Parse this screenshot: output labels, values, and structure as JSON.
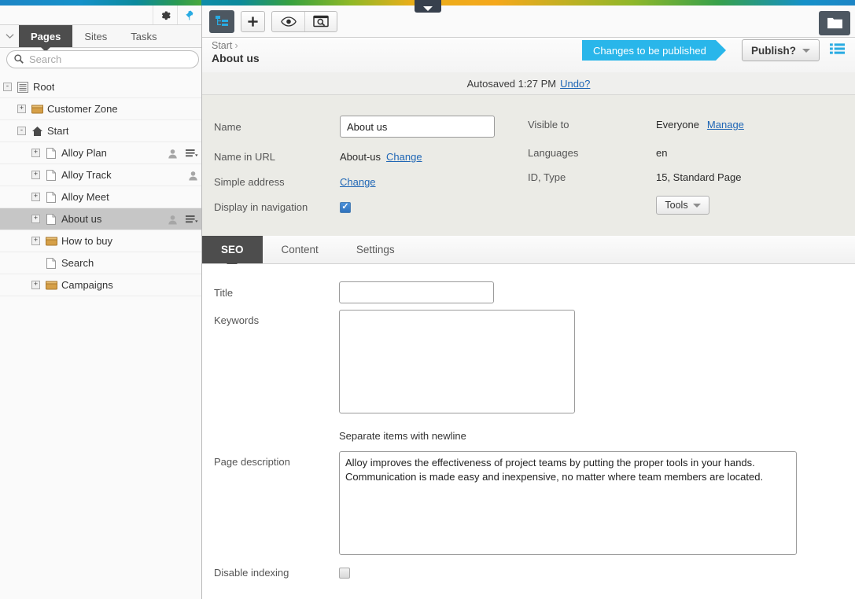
{
  "app": {
    "accent_blue": "#29b6ea",
    "dark_panel": "#4d4d4d"
  },
  "left_panel": {
    "toolbar": {
      "settings_icon": "gear-icon",
      "pin_icon": "pin-icon"
    },
    "collapse_icon": "chevron-down-icon",
    "tabs": [
      {
        "label": "Pages",
        "active": true
      },
      {
        "label": "Sites",
        "active": false
      },
      {
        "label": "Tasks",
        "active": false
      }
    ],
    "search": {
      "placeholder": "Search",
      "value": "",
      "icon": "search-icon"
    },
    "tree": [
      {
        "label": "Root",
        "level": 0,
        "expander": "-",
        "icon": "root-icon",
        "selected": false,
        "has_person": false,
        "has_menu": false
      },
      {
        "label": "Customer Zone",
        "level": 1,
        "expander": "+",
        "icon": "folder-icon",
        "selected": false,
        "has_person": false,
        "has_menu": false
      },
      {
        "label": "Start",
        "level": 1,
        "expander": "-",
        "icon": "home-icon",
        "selected": false,
        "has_person": false,
        "has_menu": false
      },
      {
        "label": "Alloy Plan",
        "level": 2,
        "expander": "+",
        "icon": "page-icon",
        "selected": false,
        "has_person": true,
        "has_menu": true
      },
      {
        "label": "Alloy Track",
        "level": 2,
        "expander": "+",
        "icon": "page-icon",
        "selected": false,
        "has_person": true,
        "has_menu": false
      },
      {
        "label": "Alloy Meet",
        "level": 2,
        "expander": "+",
        "icon": "page-icon",
        "selected": false,
        "has_person": false,
        "has_menu": false
      },
      {
        "label": "About us",
        "level": 2,
        "expander": "+",
        "icon": "page-icon",
        "selected": true,
        "has_person": true,
        "has_menu": true
      },
      {
        "label": "How to buy",
        "level": 2,
        "expander": "+",
        "icon": "folder-icon",
        "selected": false,
        "has_person": false,
        "has_menu": false
      },
      {
        "label": "Search",
        "level": 2,
        "expander": "",
        "icon": "page-icon",
        "selected": false,
        "has_person": false,
        "has_menu": false
      },
      {
        "label": "Campaigns",
        "level": 2,
        "expander": "+",
        "icon": "folder-icon",
        "selected": false,
        "has_person": false,
        "has_menu": false
      }
    ]
  },
  "main_toolbar": {
    "structure_icon": "sitemap-icon",
    "add_icon": "plus-icon",
    "preview_icon": "eye-icon",
    "inspect_icon": "page-search-icon",
    "assets_icon": "folder-icon"
  },
  "header": {
    "breadcrumb_parent": "Start",
    "breadcrumb_separator": "›",
    "title": "About us",
    "status_label": "Changes to be published",
    "publish_label": "Publish?",
    "publish_caret_icon": "chevron-down-icon",
    "list_icon": "list-icon"
  },
  "autosave": {
    "text": "Autosaved 1:27 PM",
    "undo_label": "Undo?"
  },
  "meta": {
    "name_label": "Name",
    "name_value": "About us",
    "url_label": "Name in URL",
    "url_value": "About-us",
    "url_change_label": "Change",
    "simple_address_label": "Simple address",
    "simple_address_change_label": "Change",
    "display_nav_label": "Display in navigation",
    "display_nav_checked": true,
    "visible_to_label": "Visible to",
    "visible_to_value": "Everyone",
    "manage_label": "Manage",
    "languages_label": "Languages",
    "languages_value": "en",
    "id_type_label": "ID, Type",
    "id_type_value": "15, Standard Page",
    "tools_label": "Tools",
    "tools_caret_icon": "chevron-down-icon"
  },
  "form_tabs": [
    {
      "label": "SEO",
      "active": true
    },
    {
      "label": "Content",
      "active": false
    },
    {
      "label": "Settings",
      "active": false
    }
  ],
  "seo": {
    "title_label": "Title",
    "title_value": "",
    "keywords_label": "Keywords",
    "keywords_value": "",
    "keywords_hint": "Separate items with newline",
    "description_label": "Page description",
    "description_value": "Alloy improves the effectiveness of project teams by putting the proper tools in your hands. Communication is made easy and inexpensive, no matter where team members are located.",
    "disable_indexing_label": "Disable indexing",
    "disable_indexing_checked": false
  }
}
